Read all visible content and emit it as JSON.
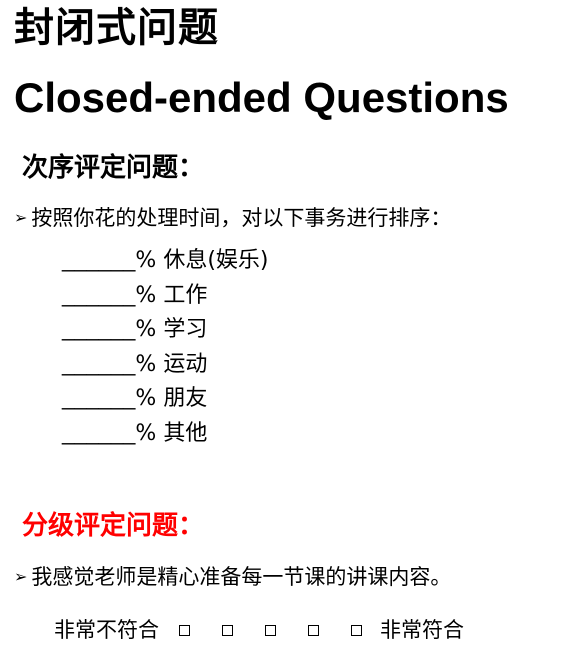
{
  "title_cn": "封闭式问题",
  "title_en": "Closed-ended Questions",
  "colors": {
    "text": "#000000",
    "heading_rank": "#000000",
    "heading_scale": "#ff0000",
    "background": "#ffffff"
  },
  "ranking": {
    "heading": "次序评定问题：",
    "question": "按照你花的处理时间，对以下事务进行排序：",
    "bullet_icon": "arrow-bullet-icon",
    "blank": "______",
    "items": [
      "% 休息(娱乐)",
      "% 工作",
      "% 学习",
      "% 运动",
      "% 朋友",
      "% 其他"
    ]
  },
  "scale": {
    "heading": "分级评定问题：",
    "question": "我感觉老师是精心准备每一节课的讲课内容。",
    "bullet_icon": "arrow-bullet-icon",
    "low_label": "非常不符合",
    "high_label": "非常符合",
    "box_count": 5
  }
}
